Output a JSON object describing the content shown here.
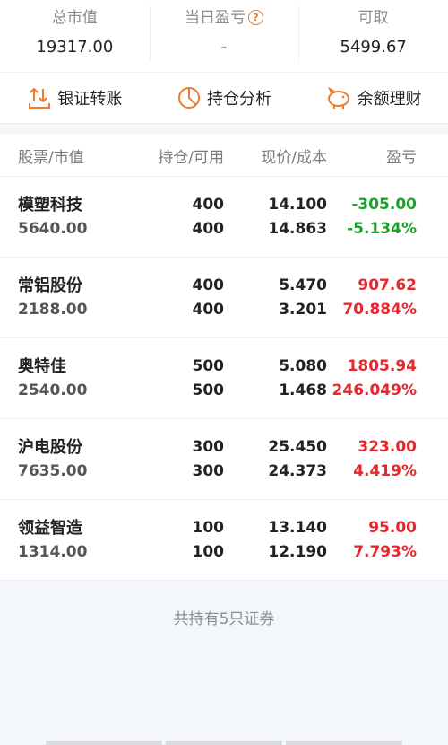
{
  "summary": {
    "market_value_label": "总市值",
    "market_value": "19317.00",
    "daily_pl_label": "当日盈亏",
    "daily_pl": "-",
    "available_label": "可取",
    "available": "5499.67"
  },
  "actions": {
    "transfer": "银证转账",
    "analysis": "持仓分析",
    "wealth": "余额理财"
  },
  "table": {
    "headers": {
      "name": "股票/市值",
      "position": "持仓/可用",
      "price": "现价/成本",
      "pl": "盈亏"
    },
    "rows": [
      {
        "name": "模塑科技",
        "value": "5640.00",
        "hold": "400",
        "avail": "400",
        "price": "14.100",
        "cost": "14.863",
        "pl": "-305.00",
        "pl_pct": "-5.134%",
        "trend": "down"
      },
      {
        "name": "常铝股份",
        "value": "2188.00",
        "hold": "400",
        "avail": "400",
        "price": "5.470",
        "cost": "3.201",
        "pl": "907.62",
        "pl_pct": "70.884%",
        "trend": "up"
      },
      {
        "name": "奥特佳",
        "value": "2540.00",
        "hold": "500",
        "avail": "500",
        "price": "5.080",
        "cost": "1.468",
        "pl": "1805.94",
        "pl_pct": "246.049%",
        "trend": "up"
      },
      {
        "name": "沪电股份",
        "value": "7635.00",
        "hold": "300",
        "avail": "300",
        "price": "25.450",
        "cost": "24.373",
        "pl": "323.00",
        "pl_pct": "4.419%",
        "trend": "up"
      },
      {
        "name": "领益智造",
        "value": "1314.00",
        "hold": "100",
        "avail": "100",
        "price": "13.140",
        "cost": "12.190",
        "pl": "95.00",
        "pl_pct": "7.793%",
        "trend": "up"
      }
    ]
  },
  "footer": "共持有5只证券",
  "colors": {
    "up": "#e8262e",
    "down": "#1aa12b",
    "accent": "#f07a2b"
  },
  "icons": [
    "transfer-icon",
    "pie-chart-icon",
    "piggy-bank-icon",
    "question-icon"
  ]
}
